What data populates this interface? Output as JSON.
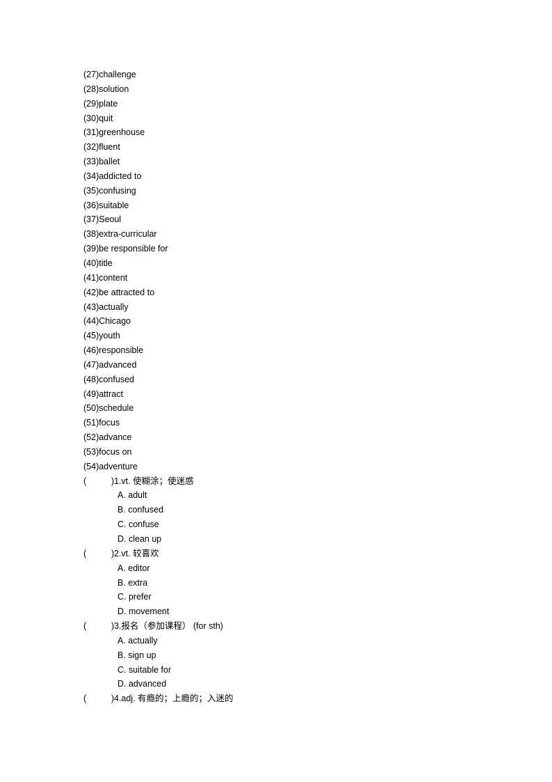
{
  "vocab_list": [
    {
      "num": "(27)",
      "word": "challenge"
    },
    {
      "num": "(28)",
      "word": "solution"
    },
    {
      "num": "(29)",
      "word": "plate"
    },
    {
      "num": "(30)",
      "word": "quit"
    },
    {
      "num": "(31)",
      "word": "greenhouse"
    },
    {
      "num": "(32)",
      "word": "fluent"
    },
    {
      "num": "(33)",
      "word": "ballet"
    },
    {
      "num": "(34)",
      "word": "addicted to"
    },
    {
      "num": "(35)",
      "word": "confusing"
    },
    {
      "num": "(36)",
      "word": "suitable"
    },
    {
      "num": "(37)",
      "word": "Seoul"
    },
    {
      "num": "(38)",
      "word": "extra-curricular"
    },
    {
      "num": "(39)",
      "word": "be responsible for"
    },
    {
      "num": "(40)",
      "word": "title"
    },
    {
      "num": "(41)",
      "word": "content"
    },
    {
      "num": "(42)",
      "word": "be attracted to"
    },
    {
      "num": "(43)",
      "word": "actually"
    },
    {
      "num": "(44)",
      "word": "Chicago"
    },
    {
      "num": "(45)",
      "word": "youth"
    },
    {
      "num": "(46)",
      "word": "responsible"
    },
    {
      "num": "(47)",
      "word": "advanced"
    },
    {
      "num": "(48)",
      "word": "confused"
    },
    {
      "num": "(49)",
      "word": "attract"
    },
    {
      "num": "(50)",
      "word": "schedule"
    },
    {
      "num": "(51)",
      "word": "focus"
    },
    {
      "num": "(52)",
      "word": "advance"
    },
    {
      "num": "(53)",
      "word": "focus on"
    },
    {
      "num": "(54)",
      "word": "adventure"
    }
  ],
  "questions": [
    {
      "open": "(",
      "close": ")",
      "stem": "1.vt.  使糊涂；使迷惑",
      "options": [
        "A. adult",
        "B. confused",
        "C. confuse",
        "D. clean up"
      ]
    },
    {
      "open": "(",
      "close": ")",
      "stem": "2.vt.  较喜欢",
      "options": [
        "A. editor",
        "B. extra",
        "C. prefer",
        "D. movement"
      ]
    },
    {
      "open": "(",
      "close": ")",
      "stem": "3.报名（参加课程）  (for sth)",
      "options": [
        "A. actually",
        "B. sign up",
        "C. suitable for",
        "D. advanced"
      ]
    },
    {
      "open": "(",
      "close": ")",
      "stem": "4.adj.  有瘾的；上瘾的；入迷的",
      "options": []
    }
  ]
}
